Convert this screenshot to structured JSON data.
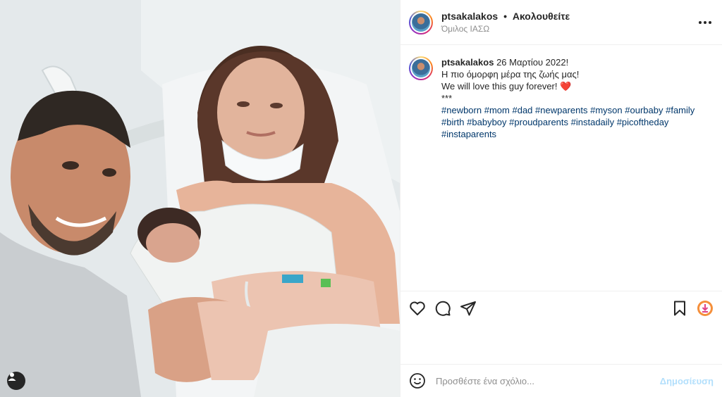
{
  "header": {
    "username": "ptsakalakos",
    "separator": "•",
    "follow_label": "Ακολουθείτε",
    "location": "Όμιλος ΙΑΣΩ"
  },
  "caption": {
    "username": "ptsakalakos",
    "date": "26 Μαρτίου 2022!",
    "line1": "Η πιο όμορφη μέρα της ζωής μας!",
    "line2": "We will love this guy forever!",
    "heart": "❤️",
    "stars": "***",
    "hashtags": [
      "#newborn",
      "#mom",
      "#dad",
      "#newparents",
      "#myson",
      "#ourbaby",
      "#family",
      "#birth",
      "#babyboy",
      "#proudparents",
      "#instadaily",
      "#picoftheday",
      "#instaparents"
    ]
  },
  "icons": {
    "like": "heart-icon",
    "comment": "comment-icon",
    "share": "share-icon",
    "save": "bookmark-icon",
    "more": "more-icon",
    "emoji": "emoji-icon",
    "tagged": "user-tag-icon"
  },
  "comment": {
    "placeholder": "Προσθέστε ένα σχόλιο...",
    "post_label": "Δημοσίευση"
  },
  "colors": {
    "link": "#00376b",
    "post_button_disabled": "#b2dffc",
    "muted": "#8e8e8e"
  }
}
